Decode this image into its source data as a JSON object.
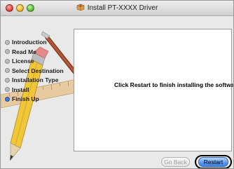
{
  "window": {
    "title": "Install PT-XXXX Driver"
  },
  "sidebar": {
    "steps": [
      {
        "label": "Introduction",
        "active": false
      },
      {
        "label": "Read Me",
        "active": false
      },
      {
        "label": "License",
        "active": false
      },
      {
        "label": "Select Destination",
        "active": false
      },
      {
        "label": "Installation Type",
        "active": false
      },
      {
        "label": "Install",
        "active": false
      },
      {
        "label": "Finish Up",
        "active": true
      }
    ]
  },
  "content": {
    "message": "Click Restart to finish installing the software."
  },
  "buttons": {
    "go_back": "Go Back",
    "restart": "Restart"
  },
  "colors": {
    "active_step": "#3e7fe0",
    "default_button": "#5f9bf0"
  }
}
